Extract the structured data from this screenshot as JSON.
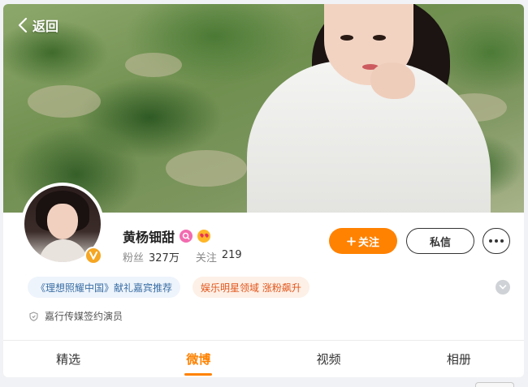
{
  "header": {
    "back_label": "返回"
  },
  "profile": {
    "name": "黄杨钿甜",
    "stats": {
      "fans_label": "粉丝",
      "fans_value": "327万",
      "following_label": "关注",
      "following_value": "219"
    },
    "tags": [
      "《理想照耀中国》献礼嘉宾推荐",
      "娱乐明星领域 涨粉飙升"
    ],
    "signature": "嘉行传媒签约演员"
  },
  "actions": {
    "follow_label": "关注",
    "message_label": "私信"
  },
  "tabs": [
    {
      "label": "精选",
      "active": false
    },
    {
      "label": "微博",
      "active": true
    },
    {
      "label": "视频",
      "active": false
    },
    {
      "label": "相册",
      "active": false
    }
  ],
  "colors": {
    "accent": "#ff8200",
    "verify": "#f5a623",
    "tag_blue_text": "#3a6ea5",
    "tag_orange_text": "#e2561c"
  },
  "icons": {
    "back": "chevron-left-icon",
    "verify": "verified-v-icon",
    "level": "user-level-icon",
    "emoji": "heart-eyes-emoji-icon",
    "plus": "plus-icon",
    "more": "more-dots-icon",
    "expand": "chevron-down-icon",
    "shield": "shield-icon"
  }
}
